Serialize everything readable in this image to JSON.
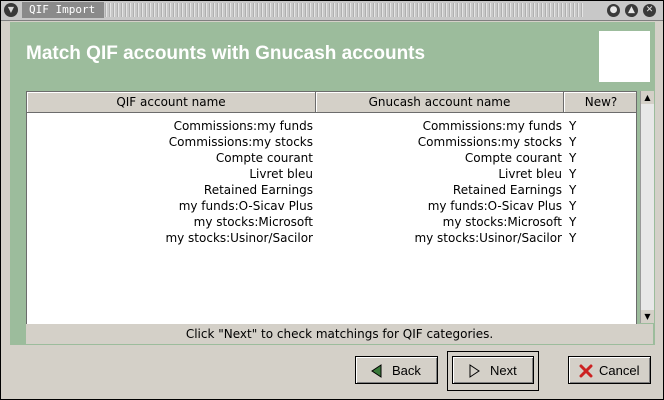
{
  "window": {
    "title": "QIF Import"
  },
  "banner": {
    "title": "Match QIF accounts with Gnucash accounts"
  },
  "table": {
    "columns": [
      "QIF account name",
      "Gnucash account name",
      "New?"
    ],
    "rows": [
      {
        "qif": "Commissions:my funds",
        "gnucash": "Commissions:my funds",
        "new": "Y"
      },
      {
        "qif": "Commissions:my stocks",
        "gnucash": "Commissions:my stocks",
        "new": "Y"
      },
      {
        "qif": "Compte courant",
        "gnucash": "Compte courant",
        "new": "Y"
      },
      {
        "qif": "Livret bleu",
        "gnucash": "Livret bleu",
        "new": "Y"
      },
      {
        "qif": "Retained Earnings",
        "gnucash": "Retained Earnings",
        "new": "Y"
      },
      {
        "qif": "my funds:O-Sicav Plus",
        "gnucash": "my funds:O-Sicav Plus",
        "new": "Y"
      },
      {
        "qif": "my stocks:Microsoft",
        "gnucash": "my stocks:Microsoft",
        "new": "Y"
      },
      {
        "qif": "my stocks:Usinor/Sacilor",
        "gnucash": "my stocks:Usinor/Sacilor",
        "new": "Y"
      }
    ]
  },
  "status": "Click \"Next\" to check matchings for QIF categories.",
  "buttons": {
    "back": "Back",
    "next": "Next",
    "cancel": "Cancel"
  },
  "icons": {
    "window_menu": "menu-icon",
    "minimize": "minimize-icon",
    "maximize": "maximize-icon",
    "close": "close-icon",
    "back": "left-arrow-icon",
    "next": "right-arrow-icon",
    "cancel": "cancel-x-icon"
  },
  "colors": {
    "banner": "#9cbc9c",
    "cancel_icon": "#cc2222"
  }
}
